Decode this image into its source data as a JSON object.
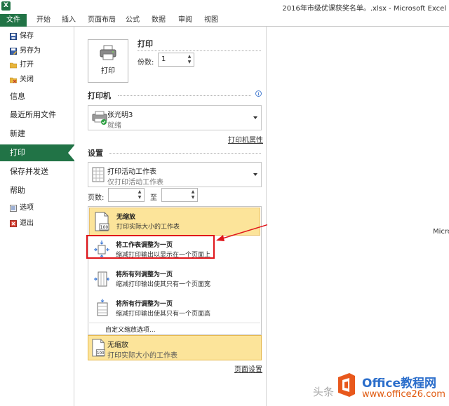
{
  "window": {
    "title": "2016年市级优课获奖名单。.xlsx - Microsoft Excel",
    "app_icon_text": "X"
  },
  "ribbon": {
    "tabs": [
      "文件",
      "开始",
      "插入",
      "页面布局",
      "公式",
      "数据",
      "审阅",
      "视图"
    ]
  },
  "nav": {
    "save": "保存",
    "save_as": "另存为",
    "open": "打开",
    "close": "关闭",
    "info": "信息",
    "recent": "最近所用文件",
    "new": "新建",
    "print": "打印",
    "save_send": "保存并发送",
    "help": "帮助",
    "options": "选项",
    "exit": "退出"
  },
  "print": {
    "section_title": "打印",
    "button_label": "打印",
    "copies_label": "份数:",
    "copies_value": "1"
  },
  "printer": {
    "section_title": "打印机",
    "info_icon": "i",
    "name": "张光明3",
    "status": "就绪",
    "properties_link": "打印机属性"
  },
  "settings": {
    "section_title": "设置",
    "what_main": "打印活动工作表",
    "what_sub": "仅打印活动工作表",
    "pages_label": "页数:",
    "pages_to_label": "至",
    "pages_from": "",
    "pages_to": ""
  },
  "scaling_menu": {
    "options": [
      {
        "title": "无缩放",
        "desc": "打印实际大小的工作表",
        "icon": "no-scaling-icon",
        "selected": true
      },
      {
        "title": "将工作表调整为一页",
        "desc": "缩减打印输出以显示在一个页面上",
        "icon": "fit-sheet-one-page-icon",
        "selected": false
      },
      {
        "title": "将所有列调整为一页",
        "desc": "缩减打印输出使其只有一个页面宽",
        "icon": "fit-columns-one-page-icon",
        "selected": false
      },
      {
        "title": "将所有行调整为一页",
        "desc": "缩减打印输出使其只有一个页面高",
        "icon": "fit-rows-one-page-icon",
        "selected": false
      }
    ],
    "custom_option": "自定义缩放选项...",
    "current_title": "无缩放",
    "current_desc": "打印实际大小的工作表",
    "icon_page_number": "100"
  },
  "page_setup_link": "页面设置",
  "preview": {
    "text": "Micro"
  },
  "watermark": {
    "brand": "Office教程网",
    "url": "www.office26.com",
    "head_text": "头条"
  },
  "colors": {
    "excel_green": "#217346",
    "selected_fill": "#fce49a",
    "highlight_red": "#e0151a"
  }
}
